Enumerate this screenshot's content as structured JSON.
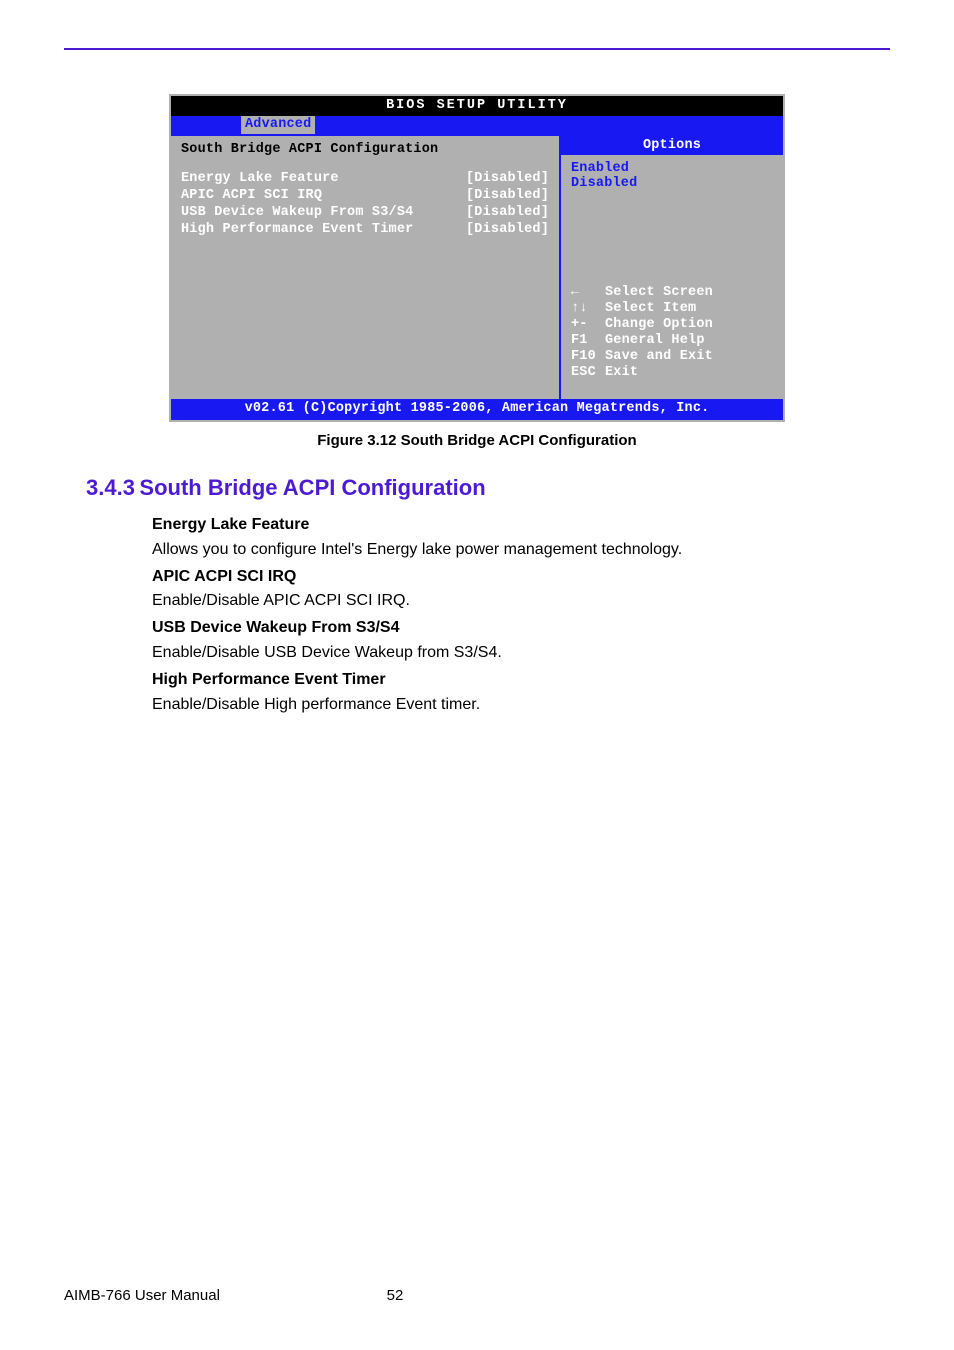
{
  "bios": {
    "title": "BIOS SETUP UTILITY",
    "tab": "Advanced",
    "section_title": "South Bridge ACPI Configuration",
    "items": [
      {
        "label": "Energy Lake Feature",
        "value": "[Disabled]"
      },
      {
        "label": "APIC ACPI SCI IRQ",
        "value": "[Disabled]"
      },
      {
        "label": "USB Device Wakeup From S3/S4",
        "value": "[Disabled]"
      },
      {
        "label": "High Performance Event Timer",
        "value": "[Disabled]"
      }
    ],
    "options_header": "Options",
    "options": [
      "Enabled",
      "Disabled"
    ],
    "keys": [
      {
        "k": "←",
        "d": "Select Screen"
      },
      {
        "k": "↑↓",
        "d": "Select Item"
      },
      {
        "k": "+-",
        "d": "Change Option"
      },
      {
        "k": "F1",
        "d": "General Help"
      },
      {
        "k": "F10",
        "d": "Save and Exit"
      },
      {
        "k": "ESC",
        "d": "Exit"
      }
    ],
    "footer": "v02.61 (C)Copyright 1985-2006, American Megatrends, Inc."
  },
  "caption": "Figure 3.12 South Bridge ACPI Configuration",
  "heading_num": "3.4.3",
  "heading_title": "South Bridge ACPI Configuration",
  "desc": [
    {
      "h": "Energy Lake Feature",
      "p": "Allows you to configure Intel's Energy lake power management technology."
    },
    {
      "h": "APIC ACPI SCI IRQ",
      "p": "Enable/Disable APIC ACPI SCI IRQ."
    },
    {
      "h": "USB Device Wakeup From S3/S4",
      "p": "Enable/Disable USB Device Wakeup from S3/S4."
    },
    {
      "h": "High Performance Event Timer",
      "p": "Enable/Disable High performance Event timer."
    }
  ],
  "footer_left": "AIMB-766 User Manual",
  "footer_page": "52"
}
